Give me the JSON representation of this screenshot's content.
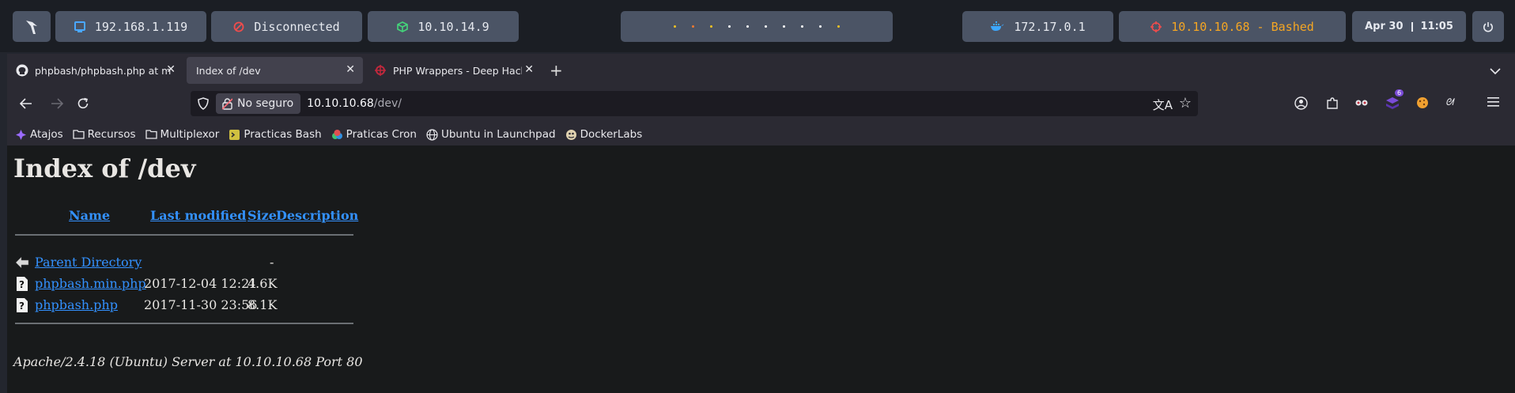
{
  "topbar": {
    "logo_icon": "arch-bird-icon",
    "local_ip": "192.168.1.119",
    "vpn_status": "Disconnected",
    "network_ip": "10.10.14.9",
    "docker_ip": "172.17.0.1",
    "target": "10.10.10.68 - Bashed",
    "date": "Apr 30",
    "time": "11:05",
    "power_icon": "power-icon",
    "colors": {
      "target": "#f5a623",
      "vpn_icon": "#f04c4c",
      "network_icon": "#44d67a",
      "docker_icon": "#3da8ff"
    }
  },
  "tabs": [
    {
      "title": "phpbash/phpbash.php at m",
      "icon": "github-icon"
    },
    {
      "title": "Index of /dev",
      "icon": ""
    },
    {
      "title": "PHP Wrappers - Deep Hack",
      "icon": "deep-hacking-icon"
    }
  ],
  "navbar": {
    "security_label": "No seguro",
    "url_host": "10.10.10.68",
    "url_path": "/dev/"
  },
  "bookmarks": [
    {
      "label": "Atajos",
      "icon": "purple-star-icon"
    },
    {
      "label": "Recursos",
      "icon": "folder-icon"
    },
    {
      "label": "Multiplexor",
      "icon": "folder-icon"
    },
    {
      "label": "Practicas Bash",
      "icon": "bash-icon"
    },
    {
      "label": "Praticas Cron",
      "icon": "cron-icon"
    },
    {
      "label": "Ubuntu in Launchpad",
      "icon": "globe-icon"
    },
    {
      "label": "DockerLabs",
      "icon": "dockerlabs-icon"
    }
  ],
  "extensions": {
    "badge_count": "6"
  },
  "page": {
    "heading": "Index of /dev",
    "columns": [
      "Name",
      "Last modified",
      "Size",
      "Description"
    ],
    "rows": [
      {
        "name": "Parent Directory",
        "modified": "",
        "size": "-",
        "icon": "back-arrow-icon"
      },
      {
        "name": "phpbash.min.php",
        "modified": "2017-12-04 12:21",
        "size": "4.6K",
        "icon": "unknown-file-icon"
      },
      {
        "name": "phpbash.php",
        "modified": "2017-11-30 23:56",
        "size": "8.1K",
        "icon": "unknown-file-icon"
      }
    ],
    "address": "Apache/2.4.18 (Ubuntu) Server at 10.10.10.68 Port 80"
  }
}
